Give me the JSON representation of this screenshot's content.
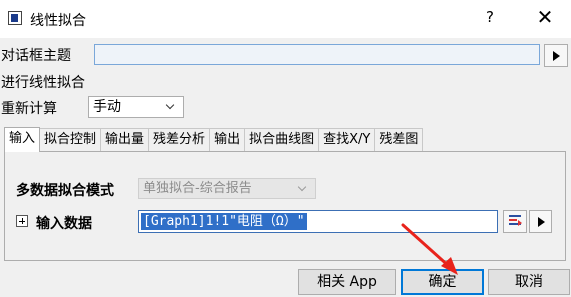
{
  "window": {
    "title": "线性拟合",
    "help_glyph": "?",
    "close_glyph": "✕",
    "icon": "app-window-icon"
  },
  "form": {
    "theme_label": "对话框主题",
    "theme_value": "",
    "section_label": "进行线性拟合",
    "recalc_label": "重新计算",
    "recalc_value": "手动"
  },
  "tabs": [
    {
      "label": "输入",
      "active": true
    },
    {
      "label": "拟合控制"
    },
    {
      "label": "输出量"
    },
    {
      "label": "残差分析"
    },
    {
      "label": "输出"
    },
    {
      "label": "拟合曲线图"
    },
    {
      "label": "查找X/Y"
    },
    {
      "label": "残差图"
    }
  ],
  "input_tab": {
    "mode_label": "多数据拟合模式",
    "mode_value": "单独拟合-综合报告",
    "data_label": "输入数据",
    "data_value": "[Graph1]1!1\"电阻（Ω）\""
  },
  "buttons": {
    "app": "相关 App",
    "ok": "确定",
    "cancel": "取消"
  },
  "annotation": {
    "color": "#e8231c",
    "points_to": "ok-button"
  }
}
